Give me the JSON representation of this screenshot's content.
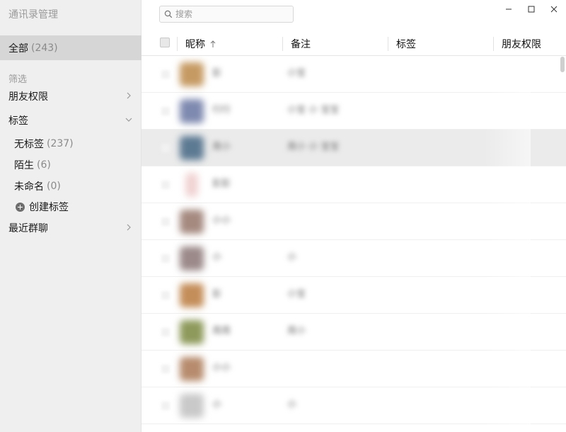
{
  "app": {
    "title": "通讯录管理"
  },
  "sidebar": {
    "all": {
      "label": "全部",
      "count": "(243)"
    },
    "filter_label": "筛选",
    "friend_perm": "朋友权限",
    "tags": "标签",
    "tag_items": [
      {
        "label": "无标签",
        "count": "(237)"
      },
      {
        "label": "陌生",
        "count": "(6)"
      },
      {
        "label": "未命名",
        "count": "(0)"
      }
    ],
    "create_tag": "创建标签",
    "recent_groups": "最近群聊"
  },
  "search": {
    "placeholder": "搜索"
  },
  "table": {
    "headers": {
      "nickname": "昵称",
      "remark": "备注",
      "tags": "标签",
      "permission": "朋友权限"
    }
  },
  "rows": [
    {
      "nickname": "彭",
      "remark": "小宝",
      "avatar_color": "#c69a63"
    },
    {
      "nickname": "行行",
      "remark": "小宝 小 宝宝",
      "avatar_color": "#7f8ab0"
    },
    {
      "nickname": "周小",
      "remark": "周小 小 宝宝",
      "avatar_color": "#5d7a93"
    },
    {
      "nickname": "彭彭",
      "remark": "",
      "avatar_color": "#e6a3a3"
    },
    {
      "nickname": "小小",
      "remark": "",
      "avatar_color": "#a58a80"
    },
    {
      "nickname": "小",
      "remark": "小",
      "avatar_color": "#9c8a8a"
    },
    {
      "nickname": "彭",
      "remark": "小宝",
      "avatar_color": "#c48e5a"
    },
    {
      "nickname": "周周",
      "remark": "周小",
      "avatar_color": "#8e9a5c"
    },
    {
      "nickname": "小小",
      "remark": "",
      "avatar_color": "#b78c6e"
    },
    {
      "nickname": "小",
      "remark": "小",
      "avatar_color": "#c9c9c9"
    }
  ],
  "colors": {
    "sidebar_bg": "#efefef",
    "selected_bg": "#d6d6d6",
    "row_selected": "#ebebeb"
  }
}
